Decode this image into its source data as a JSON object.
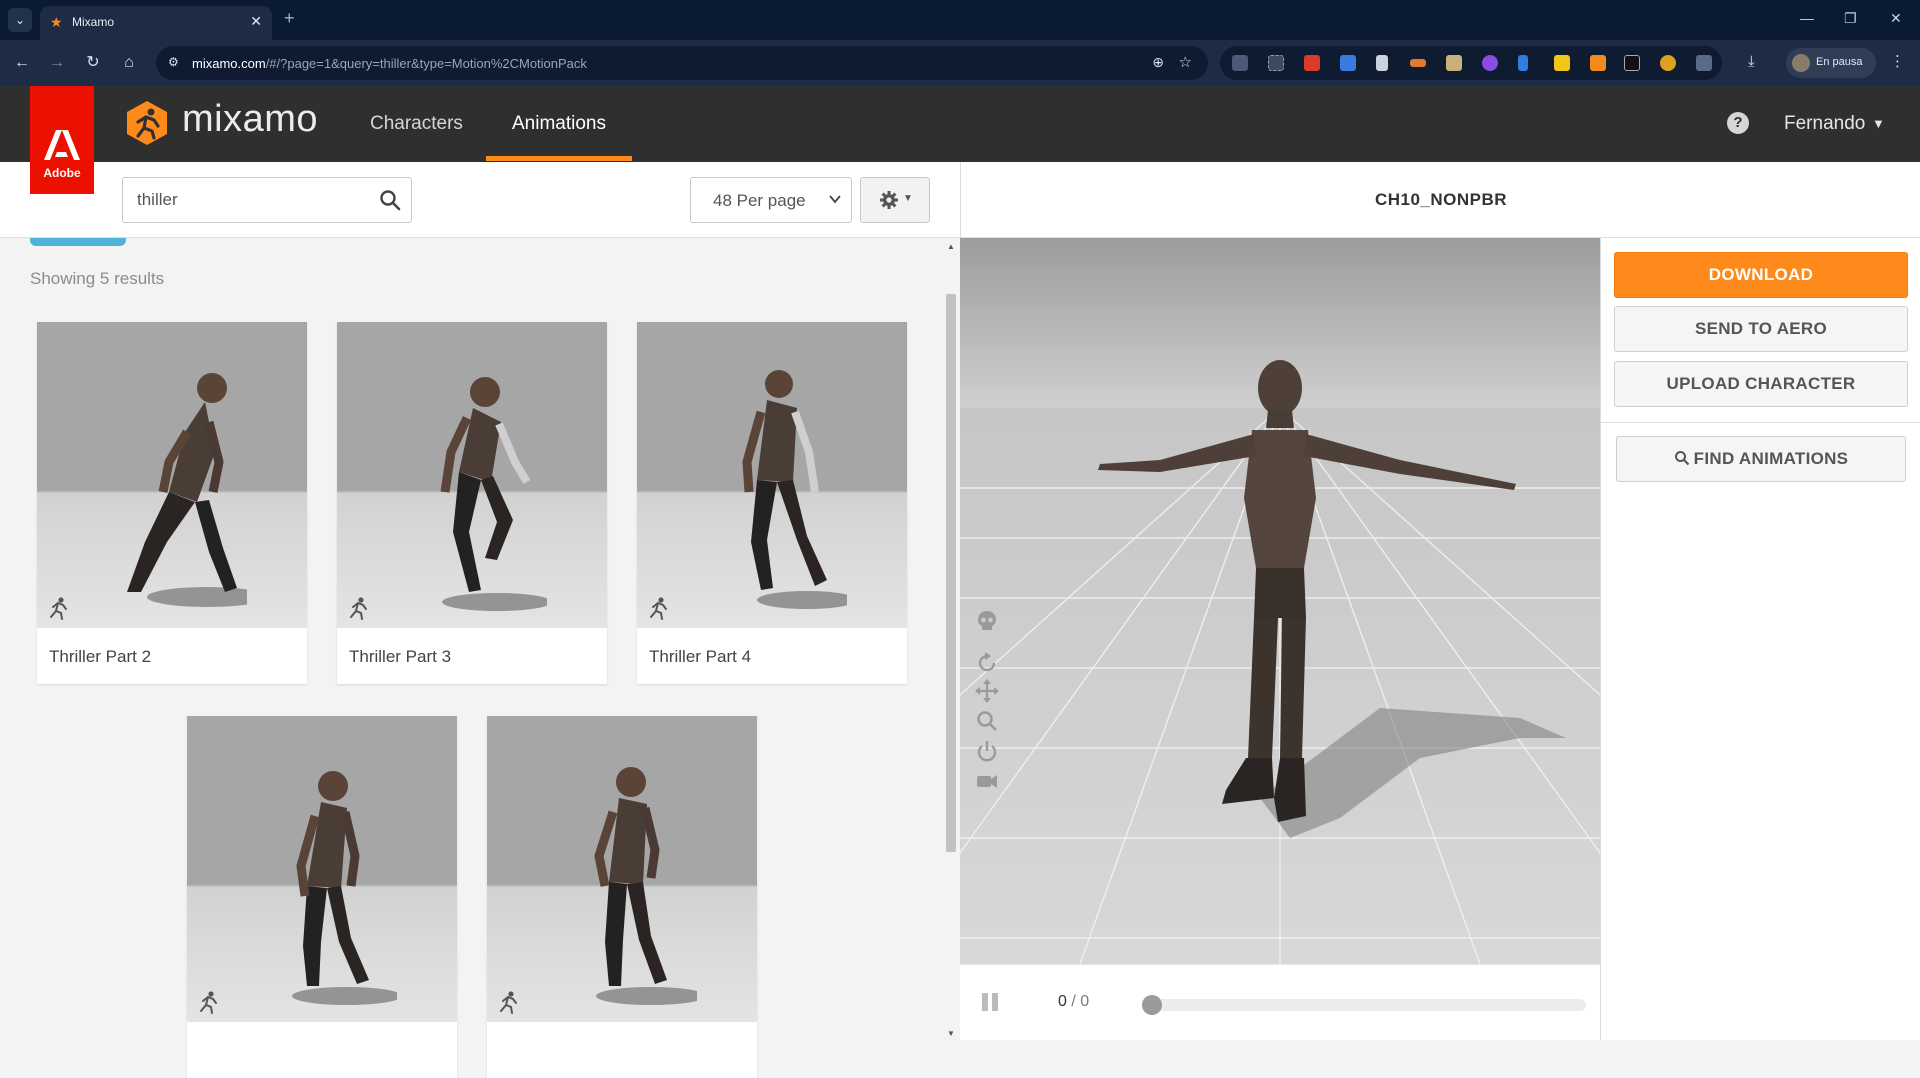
{
  "browser": {
    "tab_title": "Mixamo",
    "tab_close": "✕",
    "new_tab": "+",
    "url_host": "mixamo.com",
    "url_path": "/#/?page=1&query=thiller&type=Motion%2CMotionPack",
    "profile_status": "En pausa",
    "window_controls": [
      "—",
      "❐",
      "✕"
    ]
  },
  "header": {
    "adobe_label": "Adobe",
    "brand": "mixamo",
    "nav": [
      "Characters",
      "Animations"
    ],
    "active_nav": "Animations",
    "user": "Fernando",
    "help": "?"
  },
  "toolbar": {
    "search_value": "thiller",
    "per_page": "48 Per page"
  },
  "results": {
    "count_text": "Showing 5 results",
    "items": [
      {
        "title": "Thriller Part 2"
      },
      {
        "title": "Thriller Part 3"
      },
      {
        "title": "Thriller Part 4"
      },
      {
        "title": ""
      },
      {
        "title": ""
      }
    ]
  },
  "viewer": {
    "character": "CH10_NONPBR",
    "frame_current": "0",
    "frame_sep": " / ",
    "frame_total": "0"
  },
  "actions": {
    "download": "DOWNLOAD",
    "send_aero": "SEND TO AERO",
    "upload": "UPLOAD CHARACTER",
    "find": "FIND ANIMATIONS"
  },
  "colors": {
    "accent": "#ff8a1c",
    "header_bg": "#2f2f2f",
    "adobe_red": "#eb1000",
    "tag": "#4fb3d9"
  },
  "icons": [
    "search-icon",
    "chevron-down-icon",
    "gear-icon",
    "help-icon",
    "run-icon",
    "skull-icon",
    "rotate-icon",
    "pan-icon",
    "zoom-icon",
    "power-icon",
    "camera-icon",
    "pause-icon"
  ]
}
